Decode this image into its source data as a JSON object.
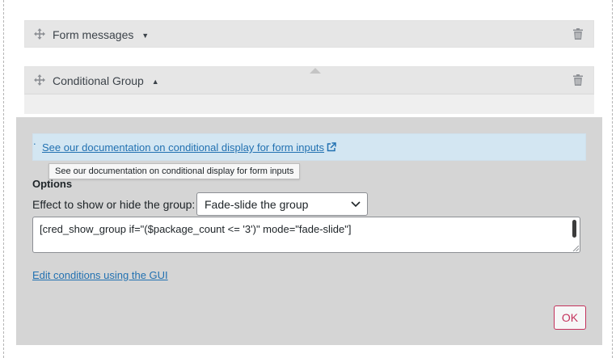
{
  "rows": [
    {
      "title": "Form messages",
      "caret_icon": "caret-down-icon",
      "move_icon": "move-icon",
      "delete_icon": "trash-icon"
    },
    {
      "title": "Conditional Group",
      "caret_icon": "caret-up-icon",
      "move_icon": "move-icon",
      "delete_icon": "trash-icon"
    }
  ],
  "panel": {
    "notice_link": "See our documentation on conditional display for form inputs",
    "notice_suffix": ".",
    "tooltip": "See our documentation on conditional display for form inputs",
    "options_title": "Options",
    "effect_label": "Effect to show or hide the group:",
    "effect_select": {
      "value": "Fade-slide the group"
    },
    "shortcode": "[cred_show_group if=\"($package_count <= '3')\" mode=\"fade-slide\"]",
    "edit_link": "Edit conditions using the GUI",
    "ok_label": "OK"
  },
  "colors": {
    "link": "#2271b1",
    "notice_bg": "#d3e6f2",
    "panel_bg": "#d5d5d5",
    "ok_accent": "#c4325c"
  }
}
